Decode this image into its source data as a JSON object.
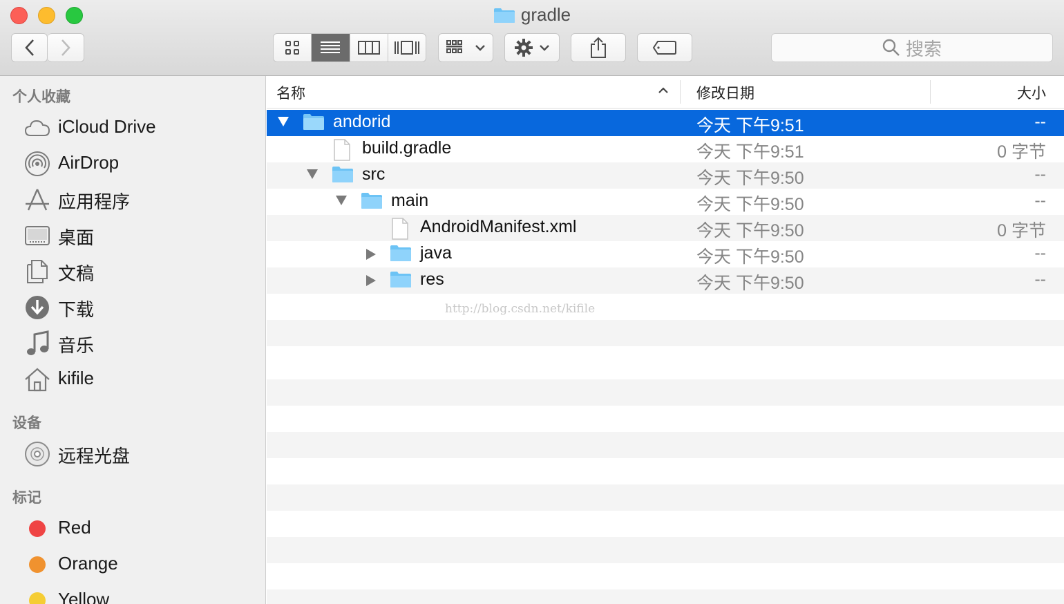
{
  "window": {
    "title": "gradle"
  },
  "toolbar": {
    "back_icon": "chevron-left-icon",
    "forward_icon": "chevron-right-icon",
    "view_modes": [
      "icon-view-icon",
      "list-view-icon",
      "column-view-icon",
      "cover-flow-icon"
    ],
    "active_view": "list-view-icon",
    "search_placeholder": "搜索"
  },
  "sidebar": {
    "favorites_title": "个人收藏",
    "favorites": [
      {
        "label": "iCloud Drive",
        "icon": "cloud-icon"
      },
      {
        "label": "AirDrop",
        "icon": "airdrop-icon"
      },
      {
        "label": "应用程序",
        "icon": "applications-icon"
      },
      {
        "label": "桌面",
        "icon": "desktop-icon"
      },
      {
        "label": "文稿",
        "icon": "documents-icon"
      },
      {
        "label": "下载",
        "icon": "download-icon"
      },
      {
        "label": "音乐",
        "icon": "music-icon"
      },
      {
        "label": "kifile",
        "icon": "home-icon"
      }
    ],
    "devices_title": "设备",
    "devices": [
      {
        "label": "远程光盘",
        "icon": "disc-icon"
      }
    ],
    "tags_title": "标记",
    "tags": [
      {
        "label": "Red",
        "color": "#ef4444"
      },
      {
        "label": "Orange",
        "color": "#f0922f"
      },
      {
        "label": "Yellow",
        "color": "#f5cd34"
      }
    ]
  },
  "columns": {
    "name": "名称",
    "date": "修改日期",
    "size": "大小"
  },
  "files": [
    {
      "name": "andorid",
      "kind": "folder",
      "depth": 0,
      "disclosure": "expanded",
      "date": "今天 下午9:51",
      "size": "--",
      "selected": true
    },
    {
      "name": "build.gradle",
      "kind": "file",
      "depth": 1,
      "disclosure": "none",
      "date": "今天 下午9:51",
      "size": "0 字节"
    },
    {
      "name": "src",
      "kind": "folder",
      "depth": 1,
      "disclosure": "expanded",
      "date": "今天 下午9:50",
      "size": "--"
    },
    {
      "name": "main",
      "kind": "folder",
      "depth": 2,
      "disclosure": "expanded",
      "date": "今天 下午9:50",
      "size": "--"
    },
    {
      "name": "AndroidManifest.xml",
      "kind": "file",
      "depth": 3,
      "disclosure": "none",
      "date": "今天 下午9:50",
      "size": "0 字节"
    },
    {
      "name": "java",
      "kind": "folder",
      "depth": 3,
      "disclosure": "collapsed",
      "date": "今天 下午9:50",
      "size": "--"
    },
    {
      "name": "res",
      "kind": "folder",
      "depth": 3,
      "disclosure": "collapsed",
      "date": "今天 下午9:50",
      "size": "--"
    }
  ],
  "watermark": "http://blog.csdn.net/kifile"
}
